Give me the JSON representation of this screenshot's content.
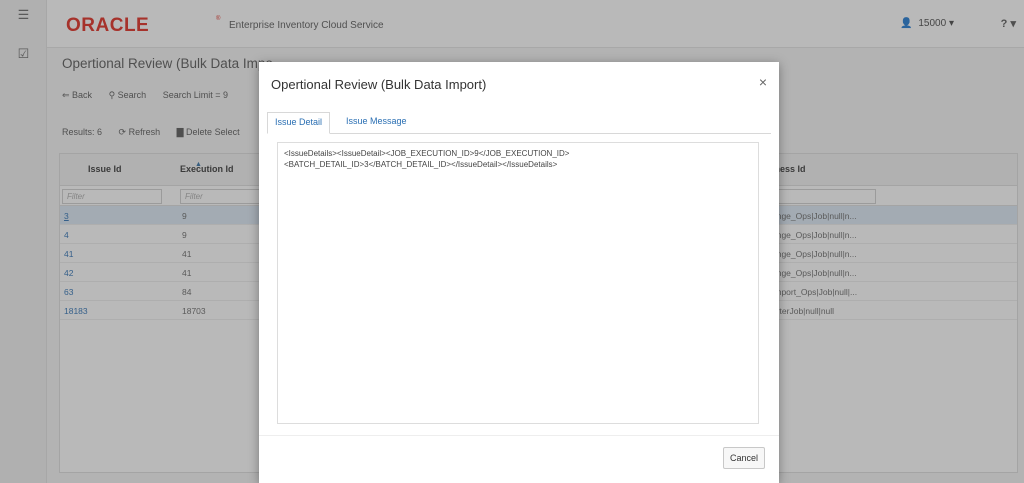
{
  "header": {
    "logo": "ORACLE",
    "logo_mark": "®",
    "app_title": "Enterprise Inventory Cloud Service",
    "user_store": "15000",
    "user_caret": "▾",
    "help_icon": "?",
    "help_caret": "▾"
  },
  "page": {
    "title": "Opertional Review (Bulk Data Impo",
    "toolbar": {
      "back": "⇐ Back",
      "search": "⚲ Search",
      "search_limit": "Search Limit = 9"
    },
    "actions": {
      "results": "Results: 6",
      "refresh": "⟳ Refresh",
      "delete": "▇ Delete Select"
    },
    "grid": {
      "columns": [
        "Issue Id",
        "Execution Id",
        "iness Id"
      ],
      "filter_placeholder": "Filter",
      "rows": [
        {
          "issue_id": "3",
          "execution_id": "9",
          "business_id": "ange_Ops|Job|null|n..."
        },
        {
          "issue_id": "4",
          "execution_id": "9",
          "business_id": "ange_Ops|Job|null|n..."
        },
        {
          "issue_id": "41",
          "execution_id": "41",
          "business_id": "ange_Ops|Job|null|n..."
        },
        {
          "issue_id": "42",
          "execution_id": "41",
          "business_id": "ange_Ops|Job|null|n..."
        },
        {
          "issue_id": "63",
          "execution_id": "84",
          "business_id": "Import_Ops|Job|null|..."
        },
        {
          "issue_id": "18183",
          "execution_id": "18703",
          "business_id": "orterJob|null|null"
        }
      ]
    }
  },
  "dialog": {
    "title": "Opertional Review (Bulk Data Import)",
    "close": "×",
    "tabs": [
      {
        "label": "Issue Detail",
        "active": true
      },
      {
        "label": "Issue Message",
        "active": false
      }
    ],
    "content_line1": "<IssueDetails><IssueDetail><JOB_EXECUTION_ID>9</JOB_EXECUTION_ID>",
    "content_line2": "<BATCH_DETAIL_ID>3</BATCH_DETAIL_ID></IssueDetail></IssueDetails>",
    "cancel": "Cancel"
  }
}
